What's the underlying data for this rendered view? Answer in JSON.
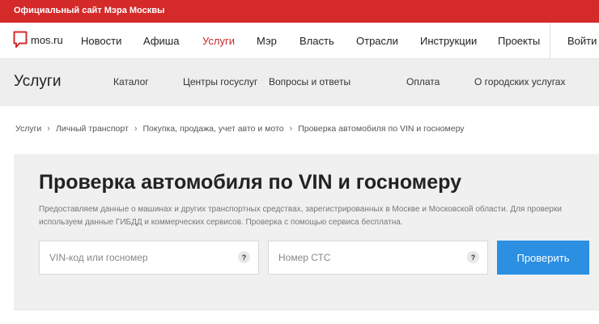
{
  "topbar": {
    "text": "Официальный сайт Мэра Москвы"
  },
  "nav": {
    "logo_text": "mos.ru",
    "items": [
      "Новости",
      "Афиша",
      "Услуги",
      "Мэр",
      "Власть",
      "Отрасли",
      "Инструкции",
      "Проекты"
    ],
    "active_item": "Услуги",
    "login_text": "Войти"
  },
  "subnav": {
    "title": "Услуги",
    "items": [
      "Каталог",
      "Центры госуслуг",
      "Вопросы и ответы",
      "Оплата",
      "О городских услугах"
    ]
  },
  "breadcrumb": [
    "Услуги",
    "Личный транспорт",
    "Покупка, продажа, учет авто и мото",
    "Проверка автомобиля по VIN и госномеру"
  ],
  "main": {
    "title": "Проверка автомобиля по VIN и госномеру",
    "description": "Предоставляем данные о машинах и других транспортных средствах, зарегистрированных в Москве и Московской области. Для проверки используем данные ГИБДД и коммерческих сервисов. Проверка с помощью сервиса бесплатна.",
    "vin_placeholder": "VIN-код или госномер",
    "sts_placeholder": "Номер СТС",
    "help_symbol": "?",
    "submit_label": "Проверить"
  },
  "colors": {
    "brand_red": "#d42a2a",
    "active_link": "#c8282a",
    "button_blue": "#2b8fe2"
  }
}
